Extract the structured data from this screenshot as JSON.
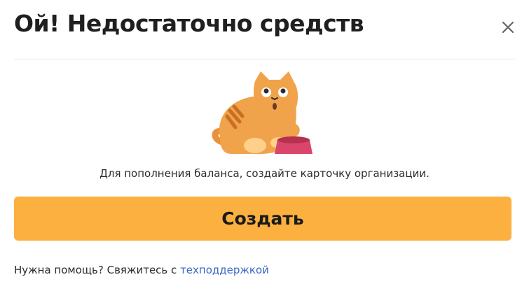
{
  "dialog": {
    "title": "Ой! Недостаточно средств",
    "close_icon": "close-icon",
    "illustration": "cat-with-bowl-illustration",
    "message": "Для пополнения баланса, создайте карточку организации.",
    "create_button_label": "Создать",
    "help_text": "Нужна помощь? Свяжитесь с",
    "help_link_label": "техподдержкой"
  },
  "colors": {
    "accent": "#fbb040",
    "link": "#3a66c4",
    "cat_body": "#f0a34a",
    "bowl": "#d9456b"
  }
}
